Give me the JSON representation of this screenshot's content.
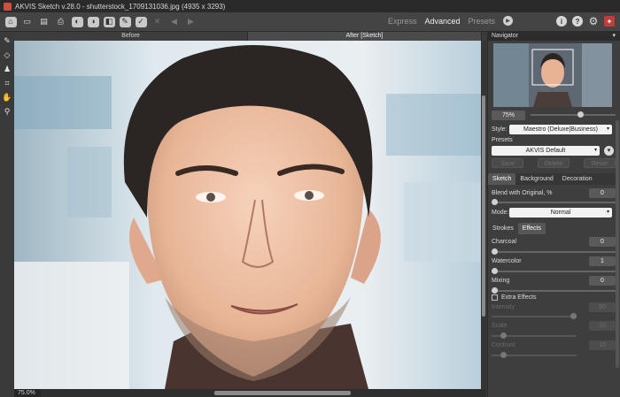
{
  "window": {
    "title": "AKVIS Sketch v.28.0 - shutterstock_1709131036.jpg (4935 x 3293)"
  },
  "toolbar": {
    "buttons": [
      "home-icon",
      "open-icon",
      "save-icon",
      "print-icon",
      "share-icon",
      "batch-icon",
      "before-after-icon",
      "preferences-icon",
      "run-icon",
      "cancel-icon",
      "undo-icon",
      "redo-icon"
    ],
    "modes": [
      "Express",
      "Advanced",
      "Presets"
    ],
    "active_mode": "Advanced"
  },
  "view_tabs": {
    "before": "Before",
    "after": "After [Sketch]"
  },
  "status": {
    "zoom": "75.0%"
  },
  "navigator": {
    "title": "Navigator",
    "zoom": "75%",
    "zoom_fraction": 0.6
  },
  "settings": {
    "style_label": "Style:",
    "style_value": "Maestro (Deluxe|Business)",
    "presets_label": "Presets",
    "preset_value": "AKVIS Default",
    "save_label": "Save",
    "delete_label": "Delete",
    "reset_label": "Reset",
    "tabs": [
      "Sketch",
      "Background",
      "Decoration"
    ],
    "active_tab": "Sketch",
    "blend_label": "Blend with Original, %",
    "blend_value": "0",
    "mode_label": "Mode:",
    "mode_value": "Normal",
    "subtabs": [
      "Strokes",
      "Effects"
    ],
    "active_subtab": "Effects",
    "charcoal_label": "Charcoal",
    "charcoal_value": "0",
    "watercolor_label": "Watercolor",
    "watercolor_value": "1",
    "mixing_label": "Mixing",
    "mixing_value": "0",
    "extra_effects_label": "Extra Effects",
    "extra_fields": [
      {
        "label": "Intensity",
        "value": "80"
      },
      {
        "label": "Scale",
        "value": "10"
      },
      {
        "label": "Contrast",
        "value": "10"
      }
    ]
  },
  "colors": {
    "background": "#3b3b3b",
    "panel": "#3e3e3e",
    "accent": "#c83a3a"
  }
}
